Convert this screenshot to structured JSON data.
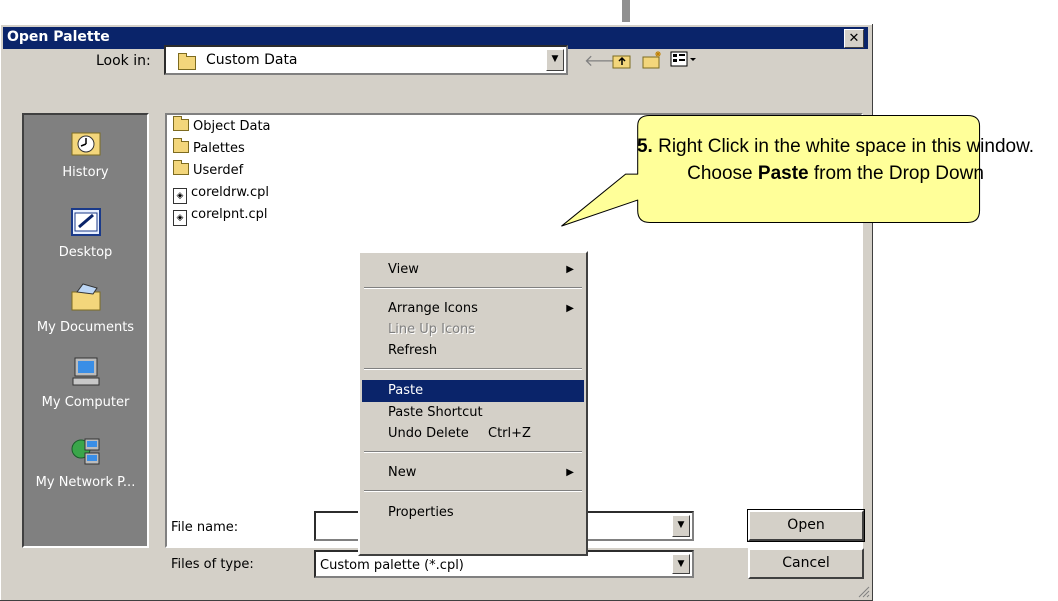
{
  "dialog": {
    "title": "Open Palette",
    "close_symbol": "✕"
  },
  "look_in": {
    "label": "Look in:",
    "value": "Custom Data"
  },
  "toolbar": {
    "back_icon": "🡐",
    "up_icon": "⬆",
    "new_folder_icon": "new-folder-icon",
    "view_menu_icon": "view-menu-icon"
  },
  "places": [
    {
      "label": "History"
    },
    {
      "label": "Desktop"
    },
    {
      "label": "My Documents"
    },
    {
      "label": "My Computer"
    },
    {
      "label": "My Network P..."
    }
  ],
  "files": [
    {
      "name": "Object Data",
      "type": "folder"
    },
    {
      "name": "Palettes",
      "type": "folder"
    },
    {
      "name": "Userdef",
      "type": "folder"
    },
    {
      "name": "coreldrw.cpl",
      "type": "file"
    },
    {
      "name": "corelpnt.cpl",
      "type": "file"
    }
  ],
  "context_menu": {
    "view": "View",
    "arrange_icons": "Arrange Icons",
    "line_up_icons": "Line Up Icons",
    "refresh": "Refresh",
    "paste": "Paste",
    "paste_shortcut": "Paste Shortcut",
    "undo_delete": "Undo Delete",
    "undo_delete_shortcut": "Ctrl+Z",
    "new": "New",
    "properties": "Properties"
  },
  "file_name": {
    "label": "File name:",
    "value": ""
  },
  "files_of_type": {
    "label": "Files of type:",
    "value": "Custom palette (*.cpl)"
  },
  "buttons": {
    "open": "Open",
    "cancel": "Cancel"
  },
  "callout": {
    "step": "5.",
    "text_1": " Right Click in the white space in this window. Choose ",
    "bold_word": "Paste",
    "text_2": " from the Drop Down",
    "fill_color": "#ffff99"
  },
  "colors": {
    "titlebar": "#0a246a",
    "dialog_bg": "#d4d0c8",
    "places_bg": "#808080",
    "highlight": "#0a246a"
  }
}
